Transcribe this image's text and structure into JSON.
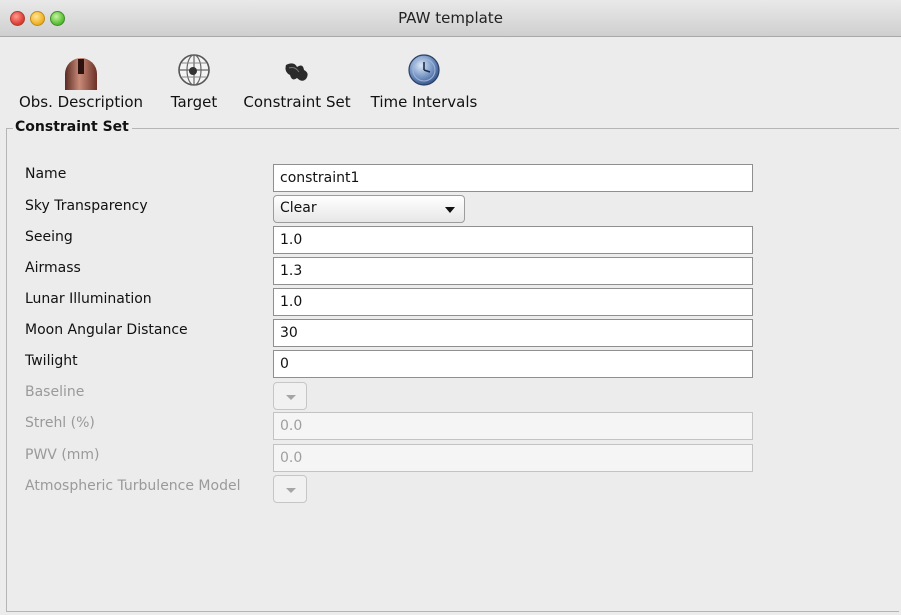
{
  "window": {
    "title": "PAW template"
  },
  "toolbar": {
    "items": [
      {
        "label": "Obs. Description",
        "icon": "telescope-dome-icon"
      },
      {
        "label": "Target",
        "icon": "globe-icon"
      },
      {
        "label": "Constraint Set",
        "icon": "cloud-icon"
      },
      {
        "label": "Time Intervals",
        "icon": "clock-icon"
      }
    ]
  },
  "constraint_set": {
    "group_title": "Constraint Set",
    "name": {
      "label": "Name",
      "value": "constraint1"
    },
    "sky_transparency": {
      "label": "Sky Transparency",
      "value": "Clear"
    },
    "seeing": {
      "label": "Seeing",
      "value": "1.0"
    },
    "airmass": {
      "label": "Airmass",
      "value": "1.3"
    },
    "lunar_illumination": {
      "label": "Lunar Illumination",
      "value": "1.0"
    },
    "moon_angular_distance": {
      "label": "Moon Angular Distance",
      "value": "30"
    },
    "twilight": {
      "label": "Twilight",
      "value": "0"
    },
    "baseline": {
      "label": "Baseline",
      "value": ""
    },
    "strehl": {
      "label": "Strehl (%)",
      "value": "0.0"
    },
    "pwv": {
      "label": "PWV (mm)",
      "value": "0.0"
    },
    "atmospheric_turbulence_model": {
      "label": "Atmospheric Turbulence Model",
      "value": ""
    }
  }
}
